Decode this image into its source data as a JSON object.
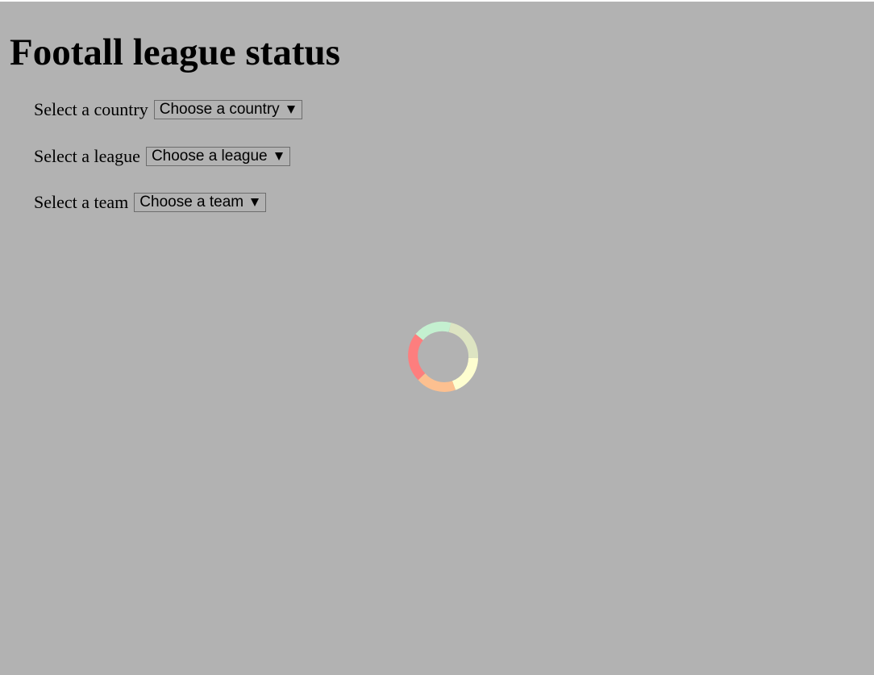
{
  "page": {
    "title": "Footall league status"
  },
  "fields": {
    "country": {
      "label": "Select a country",
      "value": "Choose a country"
    },
    "league": {
      "label": "Select a league",
      "value": "Choose a league"
    },
    "team": {
      "label": "Select a team",
      "value": "Choose a team"
    }
  },
  "loader": {
    "icon": "loading-spinner-icon",
    "colors": [
      "#c4f0d0",
      "#dde4c2",
      "#fefed0",
      "#fcc090",
      "#fd7e7e"
    ]
  },
  "colors": {
    "background": "#b2b2b2",
    "select_border": "#6d6d6d"
  }
}
